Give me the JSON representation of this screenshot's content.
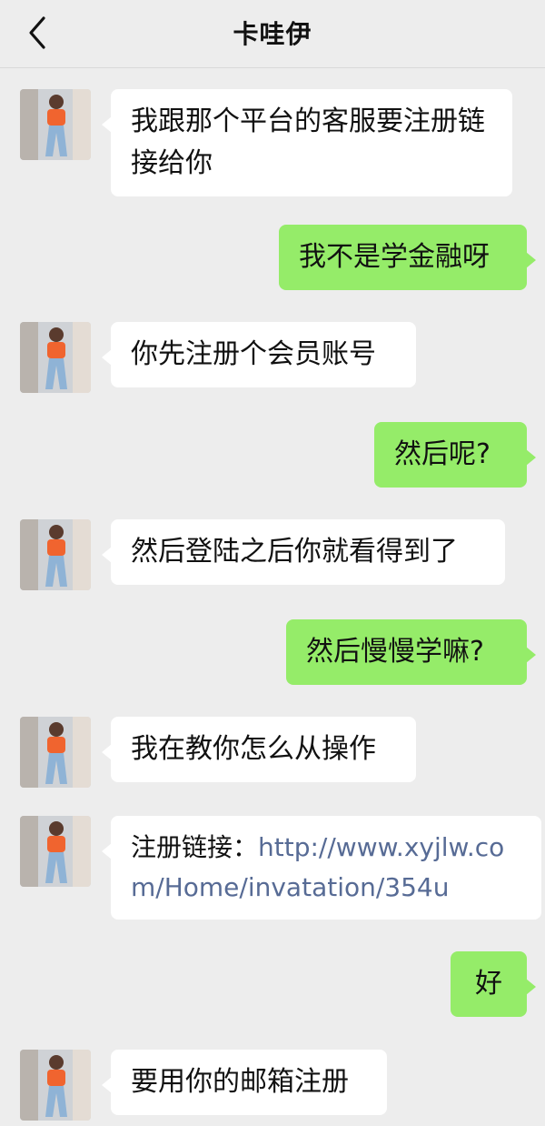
{
  "header": {
    "title": "卡哇伊"
  },
  "messages": [
    {
      "side": "left",
      "text": "我跟那个平台的客服要注册链接给你"
    },
    {
      "side": "right",
      "text": "我不是学金融呀"
    },
    {
      "side": "left",
      "text": "你先注册个会员账号"
    },
    {
      "side": "right",
      "text": "然后呢?"
    },
    {
      "side": "left",
      "text": "然后登陆之后你就看得到了"
    },
    {
      "side": "right",
      "text": "然后慢慢学嘛?"
    },
    {
      "side": "left",
      "text": "我在教你怎么从操作"
    },
    {
      "side": "left",
      "prefix": "注册链接：",
      "link": "http://www.xyjlw.com/Home/invatation/354u"
    },
    {
      "side": "right",
      "text": "好"
    },
    {
      "side": "left",
      "text": "要用你的邮箱注册"
    }
  ],
  "colors": {
    "background": "#ededed",
    "bubble_left": "#ffffff",
    "bubble_right": "#95ec69",
    "link": "#576b95"
  },
  "icons": {
    "back": "chevron-left-icon",
    "avatar": "avatar"
  }
}
